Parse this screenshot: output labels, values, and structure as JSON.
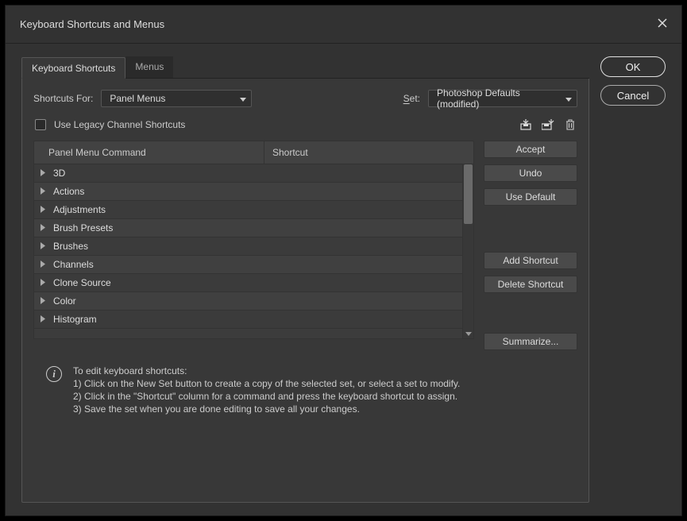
{
  "titlebar": {
    "title": "Keyboard Shortcuts and Menus"
  },
  "tabs": {
    "keyboard": "Keyboard Shortcuts",
    "menus": "Menus"
  },
  "side": {
    "ok": "OK",
    "cancel": "Cancel"
  },
  "top": {
    "shortcuts_for_label": "Shortcuts For:",
    "shortcuts_for_value": "Panel Menus",
    "set_label": "Set:",
    "set_value": "Photoshop Defaults (modified)"
  },
  "legacy": {
    "label": "Use Legacy Channel Shortcuts"
  },
  "table": {
    "col_cmd": "Panel Menu Command",
    "col_shortcut": "Shortcut",
    "rows": [
      {
        "label": "3D"
      },
      {
        "label": "Actions"
      },
      {
        "label": "Adjustments"
      },
      {
        "label": "Brush Presets"
      },
      {
        "label": "Brushes"
      },
      {
        "label": "Channels"
      },
      {
        "label": "Clone Source"
      },
      {
        "label": "Color"
      },
      {
        "label": "Histogram"
      }
    ]
  },
  "actions": {
    "accept": "Accept",
    "undo": "Undo",
    "use_default": "Use Default",
    "add_shortcut": "Add Shortcut",
    "delete_shortcut": "Delete Shortcut",
    "summarize": "Summarize..."
  },
  "instructions": {
    "heading": "To edit keyboard shortcuts:",
    "line1": "1) Click on the New Set button to create a copy of the selected set, or select a set to modify.",
    "line2": "2) Click in the \"Shortcut\" column for a command and press the keyboard shortcut to assign.",
    "line3": "3) Save the set when you are done editing to save all your changes."
  }
}
